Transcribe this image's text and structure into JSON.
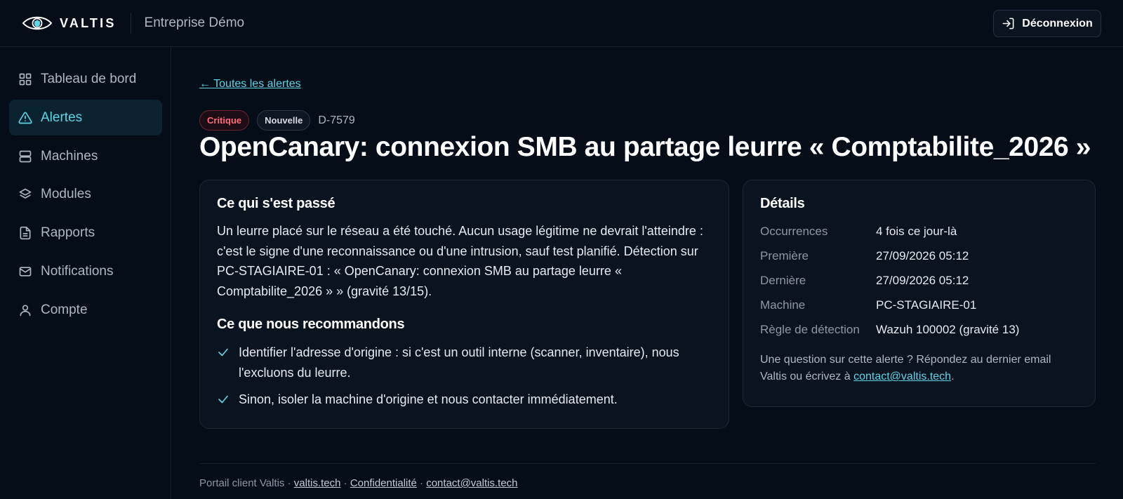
{
  "brand": {
    "name": "VALTIS",
    "company": "Entreprise Démo",
    "logo": "valtis-eye-logo"
  },
  "header": {
    "logout_label": "Déconnexion",
    "logout_icon": "sign-in-icon"
  },
  "sidebar": {
    "items": [
      {
        "label": "Tableau de bord",
        "icon": "grid-icon",
        "active": false
      },
      {
        "label": "Alertes",
        "icon": "warning-triangle-icon",
        "active": true
      },
      {
        "label": "Machines",
        "icon": "server-icon",
        "active": false
      },
      {
        "label": "Modules",
        "icon": "layers-icon",
        "active": false
      },
      {
        "label": "Rapports",
        "icon": "document-icon",
        "active": false
      },
      {
        "label": "Notifications",
        "icon": "mail-icon",
        "active": false
      },
      {
        "label": "Compte",
        "icon": "user-icon",
        "active": false
      }
    ]
  },
  "alert": {
    "back_link": "← Toutes les alertes",
    "severity": "Critique",
    "status": "Nouvelle",
    "id": "D-7579",
    "title": "OpenCanary: connexion SMB au partage leurre « Comptabilite_2026 »"
  },
  "what_happened": {
    "heading": "Ce qui s'est passé",
    "text": "Un leurre placé sur le réseau a été touché. Aucun usage légitime ne devrait l'atteindre : c'est le signe d'une reconnaissance ou d'une intrusion, sauf test planifié. Détection sur PC-STAGIAIRE-01 : « OpenCanary: connexion SMB au partage leurre « Comptabilite_2026 » » (gravité 13/15)."
  },
  "recommendations": {
    "heading": "Ce que nous recommandons",
    "items": [
      "Identifier l'adresse d'origine : si c'est un outil interne (scanner, inventaire), nous l'excluons du leurre.",
      "Sinon, isoler la machine d'origine et nous contacter immédiatement."
    ]
  },
  "details": {
    "heading": "Détails",
    "rows": [
      {
        "label": "Occurrences",
        "value": "4 fois ce jour-là"
      },
      {
        "label": "Première",
        "value": "27/09/2026 05:12"
      },
      {
        "label": "Dernière",
        "value": "27/09/2026 05:12"
      },
      {
        "label": "Machine",
        "value": "PC-STAGIAIRE-01"
      },
      {
        "label": "Règle de détection",
        "value": "Wazuh 100002 (gravité 13)"
      }
    ],
    "note_before": "Une question sur cette alerte ? Répondez au dernier email Valtis ou écrivez à ",
    "note_email": "contact@valtis.tech",
    "note_after": "."
  },
  "footer": {
    "prefix": "Portail client Valtis · ",
    "link_site": "valtis.tech",
    "sep1": " · ",
    "link_privacy": "Confidentialité",
    "sep2": " · ",
    "link_contact": "contact@valtis.tech"
  },
  "colors": {
    "background": "#040d18",
    "accent": "#5fd4e6",
    "critical": "#ff6b78"
  }
}
